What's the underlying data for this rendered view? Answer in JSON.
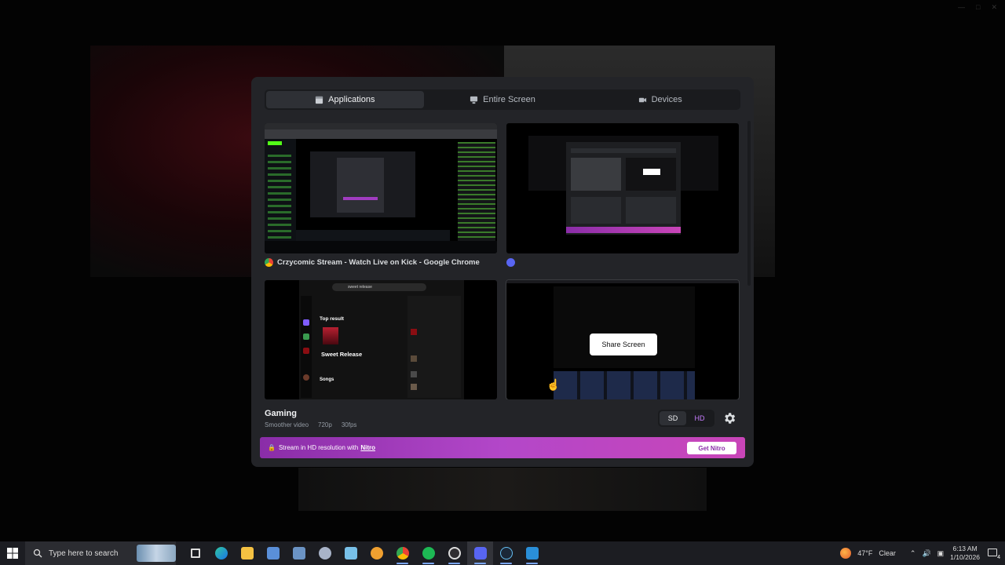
{
  "tabs": [
    {
      "label": "Applications",
      "icon": "application-icon",
      "active": true
    },
    {
      "label": "Entire Screen",
      "icon": "monitor-icon",
      "active": false
    },
    {
      "label": "Devices",
      "icon": "camera-icon",
      "active": false
    }
  ],
  "windows": [
    {
      "caption": "Crzycomic Stream - Watch Live on Kick - Google Chrome",
      "icon": "chrome-icon"
    },
    {
      "caption": "",
      "icon": "discord-icon"
    },
    {
      "caption": "",
      "icon": "spotify-icon"
    },
    {
      "caption": "",
      "icon": "obs-icon"
    }
  ],
  "spotify_preview": {
    "search_text": "sweet release",
    "top_result_label": "Top result",
    "track_title": "Sweet Release",
    "songs_label": "Songs"
  },
  "share_button_label": "Share Screen",
  "quality": {
    "title": "Gaming",
    "description": "Smoother video",
    "resolution": "720p",
    "fps": "30fps",
    "sd_label": "SD",
    "hd_label": "HD"
  },
  "nitro": {
    "message": "Stream in HD resolution with",
    "link": "Nitro",
    "button": "Get Nitro"
  },
  "taskbar": {
    "search_placeholder": "Type here to search",
    "weather_temp": "47°F",
    "weather_desc": "Clear",
    "time": "6:13 AM",
    "date": "1/10/2026",
    "notification_count": "4"
  },
  "colors": {
    "modal_bg": "#232428",
    "nitro_gradient_start": "#8a2da8",
    "nitro_gradient_end": "#c945b8",
    "hd_accent": "#c77dff"
  }
}
